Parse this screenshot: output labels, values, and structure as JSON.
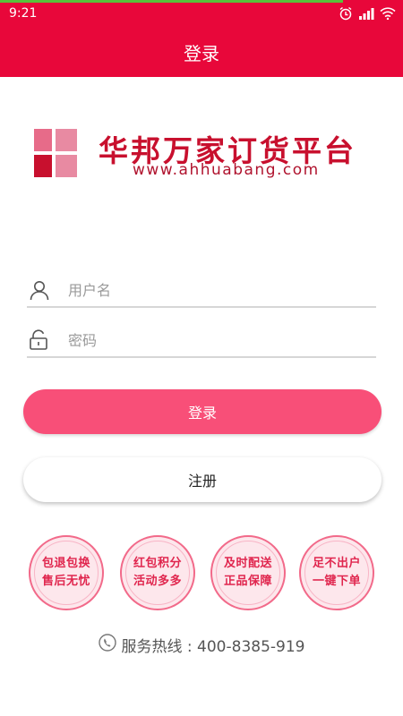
{
  "status_bar": {
    "time": "9:21",
    "icons": [
      "alarm-icon",
      "signal-icon",
      "wifi-icon"
    ],
    "progress_fraction": 0.85
  },
  "app_bar": {
    "title": "登录"
  },
  "logo": {
    "title": "华邦万家订货平台",
    "url": "www.ahhuabang.com",
    "mark_colors": [
      "#e76b89",
      "#c8102e",
      "#e88aa2"
    ]
  },
  "form": {
    "username_placeholder": "用户名",
    "password_placeholder": "密码"
  },
  "buttons": {
    "login_label": "登录",
    "register_label": "注册"
  },
  "badges": [
    {
      "line1": "包退包换",
      "line2": "售后无忧"
    },
    {
      "line1": "红包积分",
      "line2": "活动多多"
    },
    {
      "line1": "及时配送",
      "line2": "正品保障"
    },
    {
      "line1": "足不出户",
      "line2": "一键下单"
    }
  ],
  "hotline": {
    "text": "服务热线 : 400-8385-919"
  },
  "colors": {
    "primary": "#e8073a",
    "login_button": "#f84f78",
    "badge_text": "#e0264e"
  }
}
